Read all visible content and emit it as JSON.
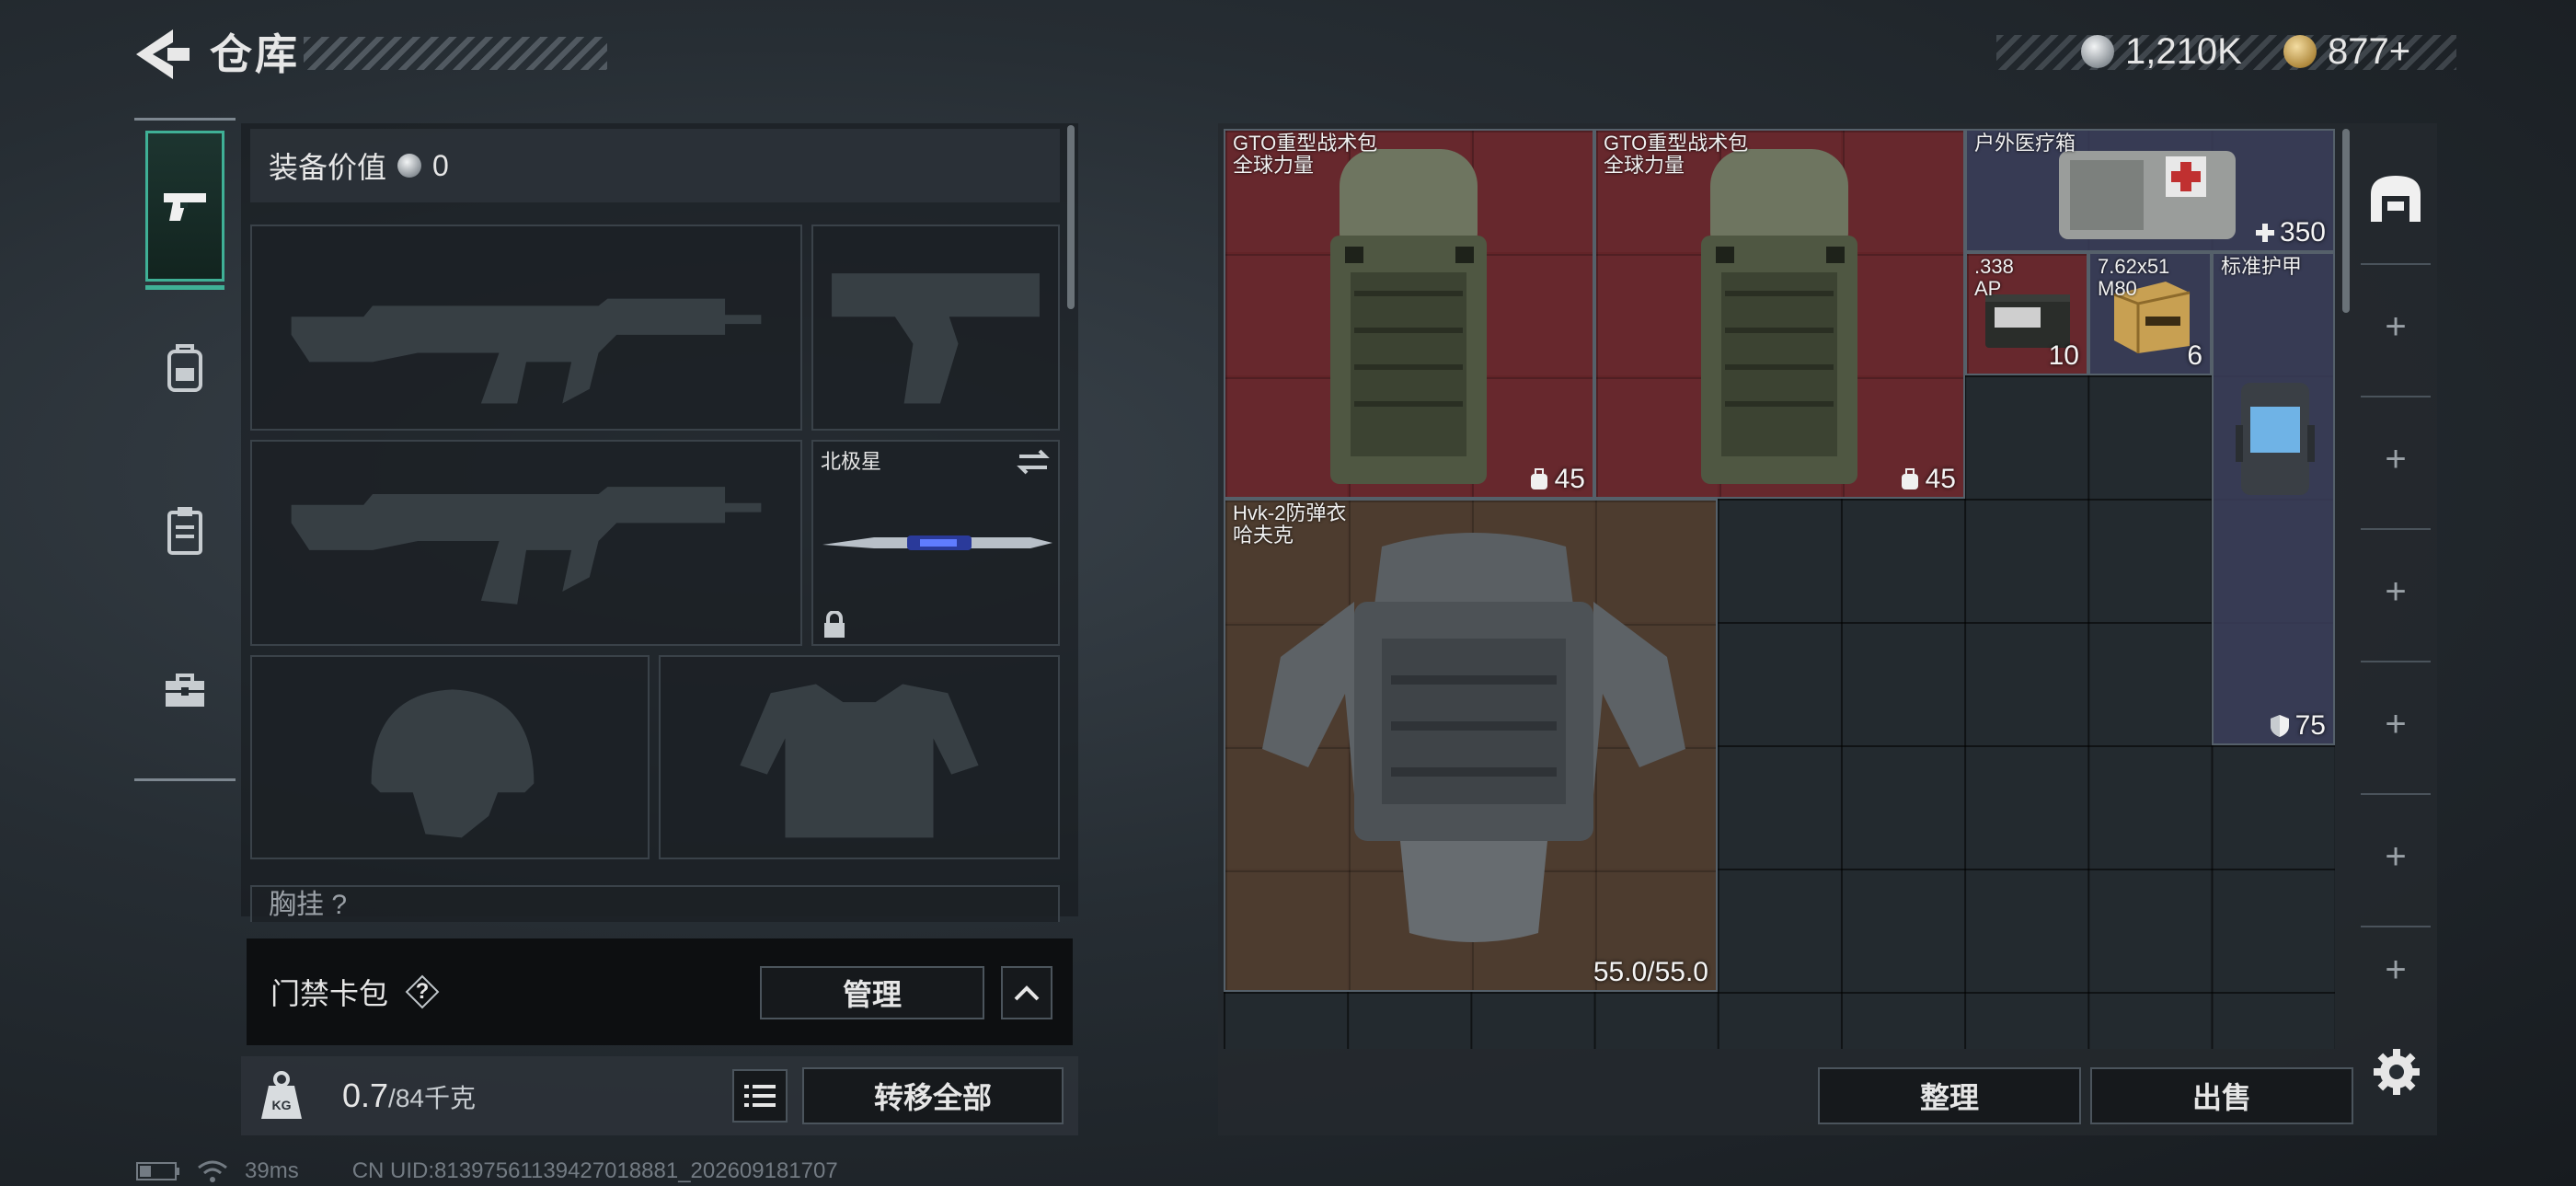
{
  "header": {
    "title": "仓库",
    "currencies": [
      {
        "icon": "silver-coin-icon",
        "value": "1,210K",
        "color": "#c9ced3"
      },
      {
        "icon": "gold-coin-icon",
        "value": "877+",
        "color": "#c9a35a"
      }
    ]
  },
  "left_tabs": [
    {
      "icon": "pistol-icon",
      "active": true
    },
    {
      "icon": "backpack-icon",
      "active": false
    },
    {
      "icon": "clipboard-icon",
      "active": false
    },
    {
      "icon": "toolbox-icon",
      "active": false
    }
  ],
  "equipment": {
    "value_label": "装备价值",
    "value": "0",
    "slots": [
      {
        "id": "primary-weapon-1",
        "label": "",
        "item": "rifle-silhouette"
      },
      {
        "id": "pistol",
        "label": "",
        "item": "pistol-silhouette"
      },
      {
        "id": "primary-weapon-2",
        "label": "",
        "item": "rifle-silhouette"
      },
      {
        "id": "melee",
        "label": "北极星",
        "item": "knife",
        "locked": true
      },
      {
        "id": "helmet",
        "label": "",
        "item": "helmet-silhouette"
      },
      {
        "id": "armor",
        "label": "",
        "item": "armor-silhouette"
      }
    ],
    "chest_rig_label": "胸挂 ?"
  },
  "keycard": {
    "label": "门禁卡包",
    "help": "?",
    "manage_label": "管理"
  },
  "weight": {
    "current": "0.7",
    "max_text": "/84千克",
    "icon_label": "KG",
    "transfer_label": "转移全部"
  },
  "stash": {
    "items": [
      {
        "name_line1": "GTO重型战术包",
        "name_line2": "全球力量",
        "count": "45",
        "count_icon": "backpack-small-icon",
        "color": "red"
      },
      {
        "name_line1": "GTO重型战术包",
        "name_line2": "全球力量",
        "count": "45",
        "count_icon": "backpack-small-icon",
        "color": "red"
      },
      {
        "name_line1": "户外医疗箱",
        "name_line2": "",
        "count": "350",
        "count_icon": "plus-icon",
        "color": "blue"
      },
      {
        "name_line1": ".338",
        "name_line2": "AP",
        "count": "10",
        "count_icon": "",
        "color": "red"
      },
      {
        "name_line1": "7.62x51",
        "name_line2": "M80",
        "count": "6",
        "count_icon": "",
        "color": "blue"
      },
      {
        "name_line1": "标准护甲",
        "name_line2": "",
        "count": "75",
        "count_icon": "shield-icon",
        "color": "blue"
      },
      {
        "name_line1": "Hvk-2防弹衣",
        "name_line2": "哈夫克",
        "count": "55.0/55.0",
        "count_icon": "",
        "color": "brown"
      }
    ],
    "sort_label": "整理",
    "sell_label": "出售",
    "side_tabs": [
      "+",
      "+",
      "+",
      "+",
      "+",
      "+"
    ]
  },
  "status": {
    "ping": "39ms",
    "uid": "CN UID:81397561139427018881_202609181707"
  },
  "colors": {
    "accent_green": "#3fb096",
    "item_red": "#76282d",
    "item_blue": "#3a3e5a",
    "item_brown": "#523e30"
  }
}
